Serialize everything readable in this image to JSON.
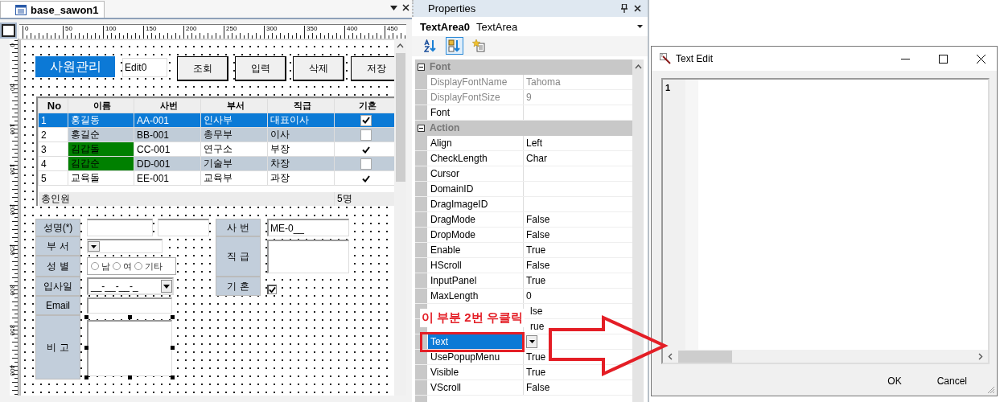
{
  "document_tab": {
    "title": "base_sawon1"
  },
  "ruler": {
    "horizontal": [
      "0",
      "50",
      "100",
      "150",
      "200",
      "250",
      "300",
      "350",
      "400",
      "450"
    ],
    "vertical": [
      "0",
      "50",
      "100",
      "150",
      "200",
      "250",
      "300",
      "350",
      "400"
    ]
  },
  "form": {
    "title": "사원관리",
    "edit_value": "Edit0",
    "buttons": [
      "조회",
      "입력",
      "삭제",
      "저장"
    ],
    "grid": {
      "columns": [
        "No",
        "이름",
        "사번",
        "부서",
        "직급",
        "기혼"
      ],
      "rows": [
        {
          "no": "1",
          "name": "홍길동",
          "emp_no": "AA-001",
          "dept": "인사부",
          "rank": "대표이사",
          "married": true,
          "selected": true
        },
        {
          "no": "2",
          "name": "홍길순",
          "emp_no": "BB-001",
          "dept": "총무부",
          "rank": "이사",
          "married": false,
          "selected": false
        },
        {
          "no": "3",
          "name": "김갑돌",
          "color": "#008000",
          "emp_no": "CC-001",
          "dept": "연구소",
          "rank": "부장",
          "married": true,
          "selected": false
        },
        {
          "no": "4",
          "name": "김갑순",
          "color": "#008000",
          "emp_no": "DD-001",
          "dept": "기술부",
          "rank": "차장",
          "married": false,
          "selected": false
        },
        {
          "no": "5",
          "name": "교육돌",
          "emp_no": "EE-001",
          "dept": "교육부",
          "rank": "과장",
          "married": true,
          "selected": false
        }
      ],
      "footer": {
        "label": "총인원",
        "count": "5명"
      }
    },
    "fields_left": [
      {
        "label": "성명(*)",
        "kind": "name"
      },
      {
        "label": "부 서",
        "kind": "combo"
      },
      {
        "label": "성 별",
        "kind": "radio",
        "options": [
          {
            "label": "남",
            "selected": false
          },
          {
            "label": "여",
            "selected": false
          },
          {
            "label": "기타",
            "selected": false
          }
        ]
      },
      {
        "label": "입사일",
        "kind": "date",
        "value": "__-__-__-_"
      },
      {
        "label": "Email",
        "kind": "text"
      },
      {
        "label": "비 고",
        "kind": "textarea",
        "selected": true
      }
    ],
    "fields_right": [
      {
        "label": "사 번",
        "kind": "text",
        "value": "ME-0__"
      },
      {
        "label": "직 급",
        "kind": "textarea"
      },
      {
        "label": "기 혼",
        "kind": "checkbox",
        "checked": true
      }
    ]
  },
  "properties": {
    "title": "Properties",
    "object_name": "TextArea0",
    "object_type": "TextArea",
    "toolbar": [
      {
        "kind": "alphabetical",
        "selected": false
      },
      {
        "kind": "categorized",
        "selected": true
      },
      {
        "kind": "events",
        "selected": false
      }
    ],
    "groups": [
      {
        "name": "Font",
        "expanded": true,
        "rows": [
          {
            "name": "DisplayFontName",
            "value": "Tahoma",
            "disabled": true,
            "selected": false
          },
          {
            "name": "DisplayFontSize",
            "value": "9",
            "disabled": true,
            "selected": false
          },
          {
            "name": "Font",
            "disabled": false,
            "selected": false
          }
        ]
      },
      {
        "name": "Action",
        "expanded": true,
        "rows": [
          {
            "name": "Align",
            "value": "Left",
            "disabled": false,
            "selected": false
          },
          {
            "name": "CheckLength",
            "value": "Char",
            "disabled": false,
            "selected": false
          },
          {
            "name": "Cursor",
            "disabled": false,
            "selected": false
          },
          {
            "name": "DomainID",
            "disabled": false,
            "selected": false
          },
          {
            "name": "DragImageID",
            "disabled": false,
            "selected": false
          },
          {
            "name": "DragMode",
            "value": "False",
            "disabled": false,
            "selected": false
          },
          {
            "name": "DropMode",
            "value": "False",
            "disabled": false,
            "selected": false
          },
          {
            "name": "Enable",
            "value": "True",
            "disabled": false,
            "selected": false
          },
          {
            "name": "HScroll",
            "value": "False",
            "disabled": false,
            "selected": false
          },
          {
            "name": "InputPanel",
            "value": "True",
            "disabled": false,
            "selected": false
          },
          {
            "name": "MaxLength",
            "value": "0",
            "disabled": false,
            "selected": false
          },
          {
            "value": "lse",
            "disabled": false,
            "selected": false
          },
          {
            "value": "rue",
            "disabled": false,
            "selected": false
          },
          {
            "name": "Text",
            "disabled": false,
            "selected": true
          },
          {
            "name": "UsePopupMenu",
            "value": "True",
            "disabled": false,
            "selected": false
          },
          {
            "name": "Visible",
            "value": "True",
            "disabled": false,
            "selected": false
          },
          {
            "name": "VScroll",
            "value": "False",
            "disabled": false,
            "selected": false
          }
        ]
      }
    ]
  },
  "annotation": {
    "text": "이 부분 2번 우클릭"
  },
  "dialog": {
    "title": "Text Edit",
    "line_numbers": [
      "1"
    ],
    "buttons": [
      "OK",
      "Cancel"
    ]
  }
}
